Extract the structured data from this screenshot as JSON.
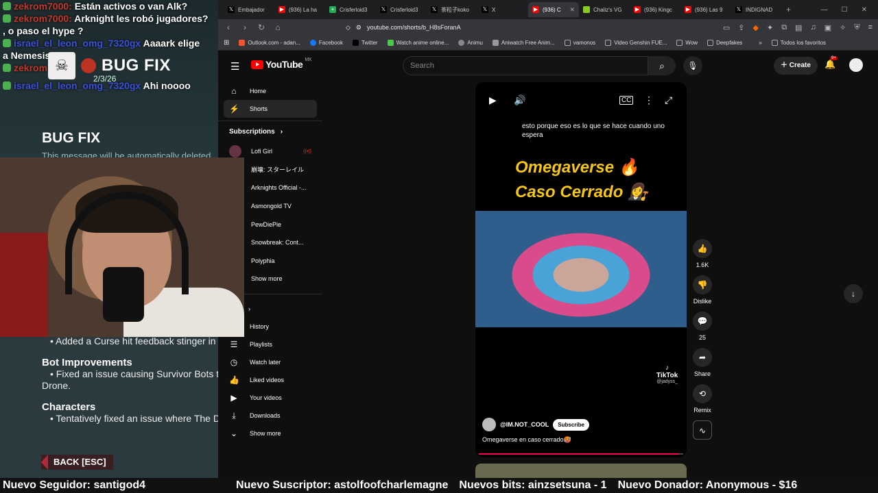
{
  "stream": {
    "chat": [
      {
        "user": "zekrom7000:",
        "text": "Están activos o van Alk?",
        "color": "red"
      },
      {
        "user": "",
        "text": ", o paso el hype ?",
        "color": "red",
        "prefix_user": "zekrom7000:",
        "prefix_text": "Arknight les robó jugadores?"
      },
      {
        "user": "israel_el_leon_omg_7320gx",
        "text": "Aaaark elige",
        "color": "blue"
      },
      {
        "user": "",
        "text": "a Nemesis",
        "color": "blue"
      },
      {
        "user": "zekrom7000",
        "text": "",
        "color": "red"
      },
      {
        "user": "israel_el_leon_omg_7320gx",
        "text": "Ahi noooo",
        "color": "blue"
      }
    ],
    "bugfix_title": "BUG FIX",
    "bugfix_date": "2/3/26",
    "patch_title": "BUG FIX",
    "patch_sub": "This message will be automatically deleted",
    "patch_lines": {
      "line1": "• Added a Curse hit feedback stinger in",
      "bot_heading": "Bot Improvements",
      "bot_line1": "• Fixed an issue causing Survivor Bots t",
      "bot_line2": "Drone.",
      "char_heading": "Characters",
      "char_line1": "• Tentatively fixed an issue where The D"
    },
    "back_label": "BACK [ESC]"
  },
  "browser": {
    "tabs": [
      {
        "label": "Embajador",
        "color": "#000000",
        "icon": "x-icon"
      },
      {
        "label": "(936) La ha",
        "color": "#ff0000",
        "icon": "youtube-icon"
      },
      {
        "label": "Crisferloid3",
        "color": "#22aa55",
        "icon": "plus-icon"
      },
      {
        "label": "Crisferloid3",
        "color": "#000000",
        "icon": "x-icon"
      },
      {
        "label": "茶粒子koko",
        "color": "#000000",
        "icon": "x-icon"
      },
      {
        "label": "X",
        "color": "#000000",
        "icon": "x-icon"
      },
      {
        "label": "(936) C",
        "color": "#ff0000",
        "icon": "youtube-icon",
        "active": true
      },
      {
        "label": "Chaliz's VG",
        "color": "#88cc22",
        "icon": "circle-icon"
      },
      {
        "label": "(936) Kingc",
        "color": "#ff0000",
        "icon": "youtube-icon"
      },
      {
        "label": "(936) Las 9",
        "color": "#ff0000",
        "icon": "youtube-icon"
      },
      {
        "label": "INDIGNAD",
        "color": "#000000",
        "icon": "x-icon"
      }
    ],
    "url": "youtube.com/shorts/b_H8sForanA",
    "bookmarks": [
      "Outlook.com - adan...",
      "Facebook",
      "Twitter",
      "Watch anime online...",
      "Animu",
      "Aniwatch Free Anim...",
      "vamonos",
      "Video Genshin FUE...",
      "Wow",
      "Deepfakes"
    ],
    "bookmarks_all": "Todos los favoritos"
  },
  "youtube": {
    "logo": "YouTube",
    "region": "MX",
    "search_placeholder": "Search",
    "create_label": "Create",
    "notif_count": "9+",
    "sidebar": {
      "home": "Home",
      "shorts": "Shorts",
      "subscriptions": "Subscriptions",
      "subs": [
        "Lofi Girl",
        "崩壊: スターレイル",
        "Arknights Official -...",
        "Asmongold TV",
        "PewDiePie",
        "Snowbreak: Cont...",
        "Polyphia"
      ],
      "show_more": "Show more",
      "history": "History",
      "playlists": "Playlists",
      "watch_later": "Watch later",
      "liked": "Liked videos",
      "your_videos": "Your videos",
      "downloads": "Downloads",
      "show_more2": "Show more"
    },
    "short": {
      "caption": "esto porque eso es lo que se hace cuando uno espera",
      "title1": "Omegaverse 🔥",
      "title2": "Caso Cerrado 👩‍⚖️",
      "tiktok": "TikTok",
      "tiktok_user": "@jadyss_",
      "channel": "@IM.NOT_COOL",
      "subscribe": "Subscribe",
      "description": "Omegaverse en caso cerrado🥵",
      "progress": 0.98
    },
    "actions": {
      "likes": "1.6K",
      "dislike": "Dislike",
      "comments": "25",
      "share": "Share",
      "remix": "Remix"
    }
  },
  "ticker": [
    "Nuevo Seguidor: santigod4",
    "Nuevo Suscriptor: astolfoofcharlemagne",
    "Nuevos bits: ainzsetsuna - 1",
    "Nuevo Donador: Anonymous - $16"
  ]
}
